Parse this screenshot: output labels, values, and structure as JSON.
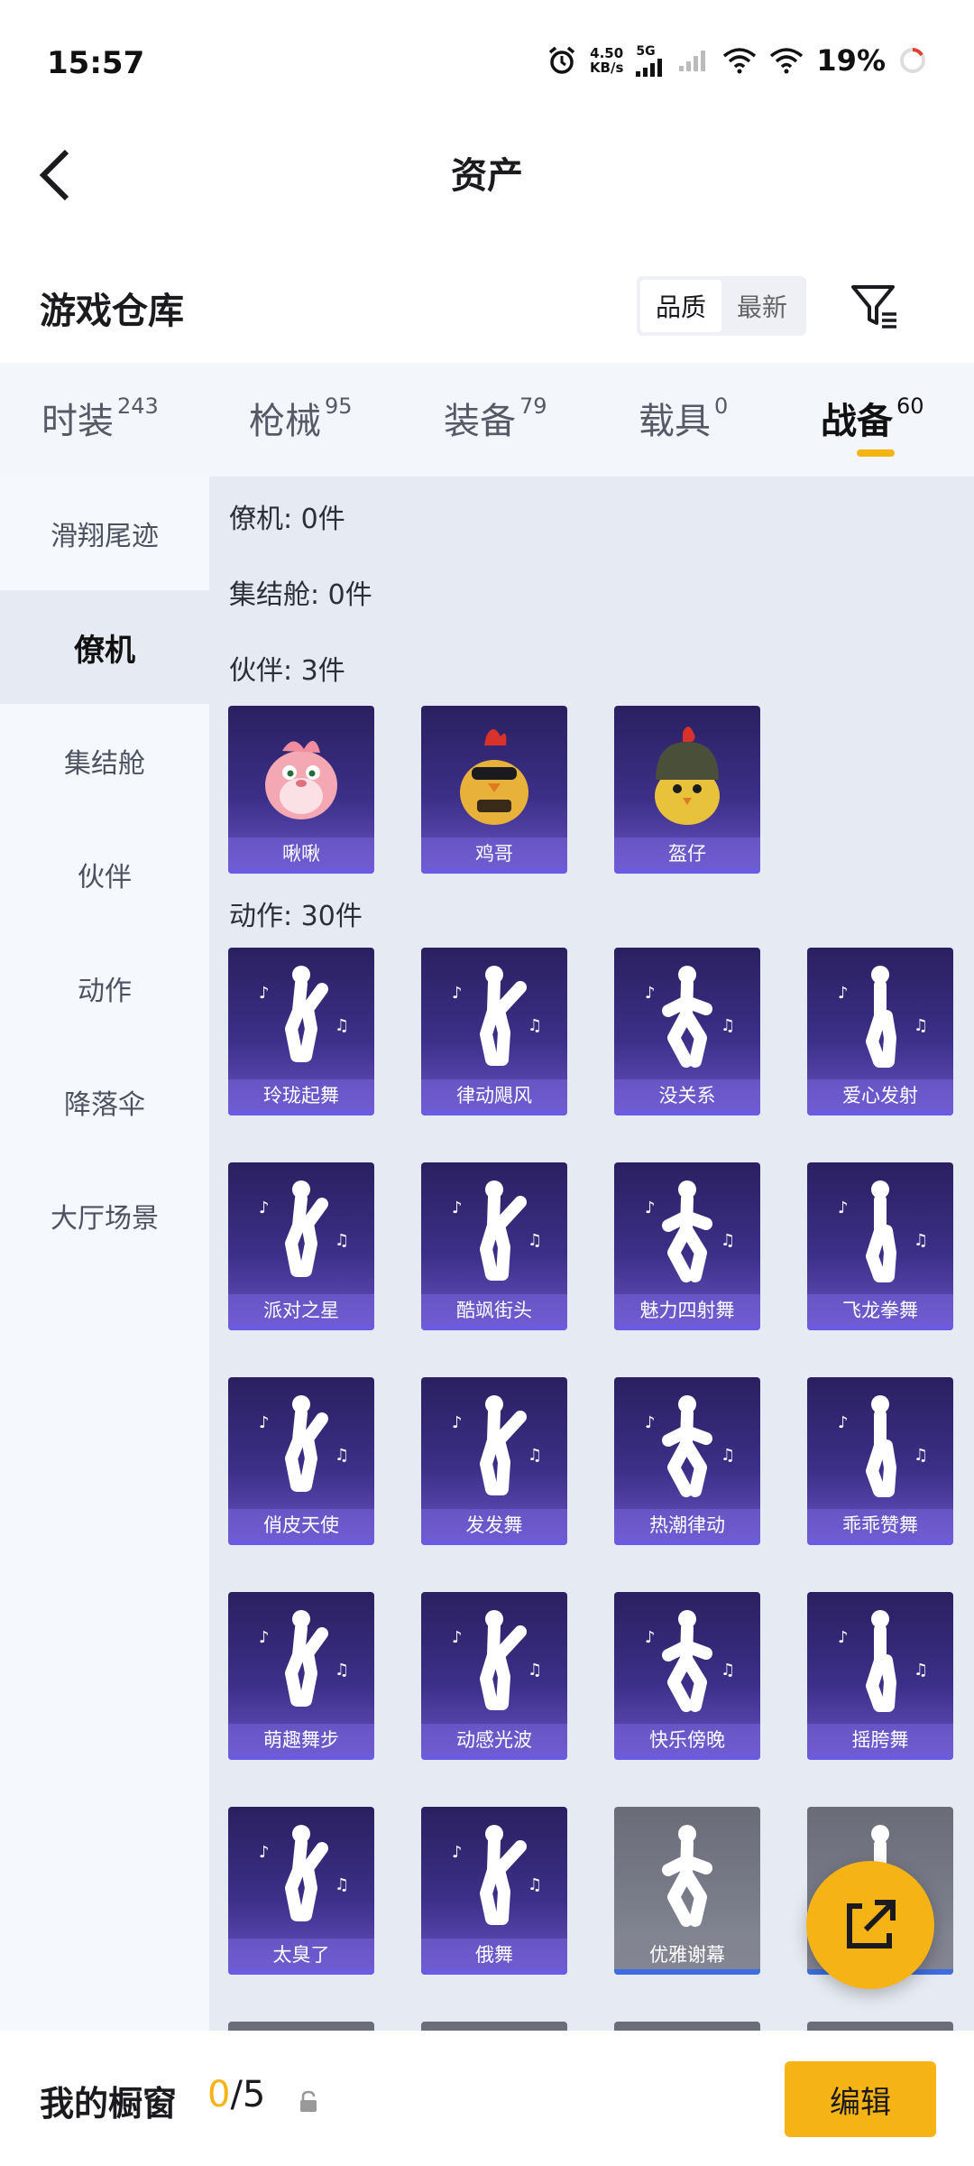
{
  "status_bar": {
    "time": "15:57",
    "net_speed_value": "4.50",
    "net_speed_unit": "KB/s",
    "network_type": "5G",
    "battery": "19%"
  },
  "header": {
    "title": "资产"
  },
  "warehouse": {
    "title": "游戏仓库",
    "sort_options": [
      "品质",
      "最新"
    ],
    "sort_active": "品质"
  },
  "main_tabs": [
    {
      "label": "时装",
      "count": "243"
    },
    {
      "label": "枪械",
      "count": "95"
    },
    {
      "label": "装备",
      "count": "79"
    },
    {
      "label": "载具",
      "count": "0"
    },
    {
      "label": "战备",
      "count": "60",
      "active": true
    }
  ],
  "sidebar": {
    "items": [
      "滑翔尾迹",
      "僚机",
      "集结舱",
      "伙伴",
      "动作",
      "降落伞",
      "大厅场景"
    ],
    "active": "僚机"
  },
  "sections": {
    "wingman": "僚机: 0件",
    "capsule": "集结舱: 0件",
    "partner": "伙伴: 3件",
    "emote": "动作: 30件"
  },
  "partners": [
    "啾啾",
    "鸡哥",
    "盔仔"
  ],
  "emotes": [
    "玲珑起舞",
    "律动飓风",
    "没关系",
    "爱心发射",
    "派对之星",
    "酷飒街头",
    "魅力四射舞",
    "飞龙拳舞",
    "俏皮天使",
    "发发舞",
    "热潮律动",
    "乖乖赞舞",
    "萌趣舞步",
    "动感光波",
    "快乐傍晚",
    "摇胯舞",
    "太臭了",
    "俄舞",
    "优雅谢幕",
    ""
  ],
  "bottom": {
    "window_label": "我的橱窗",
    "window_current": "0",
    "window_total": "/5",
    "edit_label": "编辑"
  },
  "colors": {
    "accent": "#f5b316",
    "card_purple": "#3c2f88",
    "card_gray": "#7a7d8a"
  }
}
